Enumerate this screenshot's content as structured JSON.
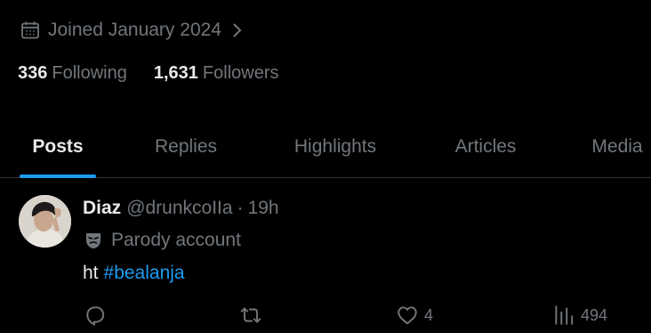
{
  "profile": {
    "joined_text": "Joined January 2024",
    "following_count": "336",
    "following_label": "Following",
    "followers_count": "1,631",
    "followers_label": "Followers"
  },
  "tabs": [
    {
      "label": "Posts",
      "active": true
    },
    {
      "label": "Replies"
    },
    {
      "label": "Highlights"
    },
    {
      "label": "Articles"
    },
    {
      "label": "Media"
    }
  ],
  "tweet": {
    "display_name": "Diaz",
    "handle": "@drunkcoIIa",
    "separator": "·",
    "time": "19h",
    "parody_label": "Parody account",
    "text": "ht",
    "hashtag": "#bealanja",
    "actions": {
      "reply_count": "",
      "retweet_count": "",
      "like_count": "4",
      "views_count": "494"
    }
  },
  "colors": {
    "background": "#000000",
    "text_primary": "#e7e9ea",
    "text_secondary": "#71767b",
    "accent": "#1d9bf0",
    "divider": "#2f3336"
  },
  "icons": [
    "calendar-icon",
    "chevron-right-icon",
    "parody-mask-icon",
    "reply-icon",
    "retweet-icon",
    "like-icon",
    "views-icon"
  ]
}
